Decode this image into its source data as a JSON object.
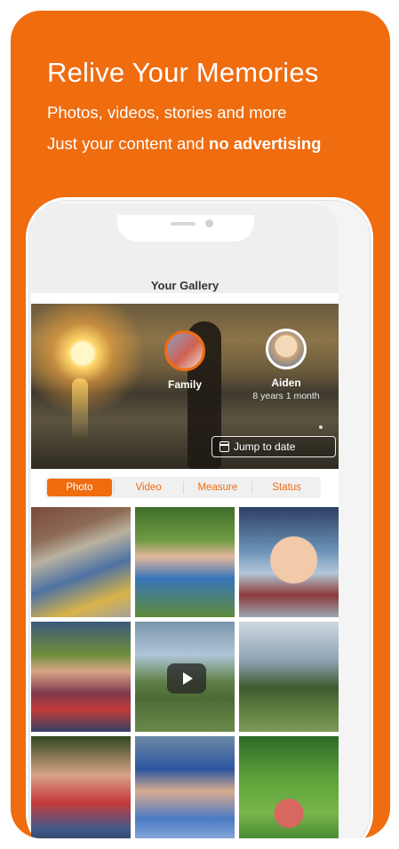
{
  "promo": {
    "title": "Relive Your Memories",
    "line1": "Photos, videos, stories and more",
    "line2_prefix": "Just your content and ",
    "line2_bold": "no advertising"
  },
  "app": {
    "screen_title": "Your Gallery",
    "profiles": [
      {
        "name": "Family",
        "age": ""
      },
      {
        "name": "Aiden",
        "age": "8 years 1 month"
      }
    ],
    "jump_button": "Jump to date",
    "tabs": [
      {
        "label": "Photo",
        "active": true
      },
      {
        "label": "Video",
        "active": false
      },
      {
        "label": "Measure",
        "active": false
      },
      {
        "label": "Status",
        "active": false
      }
    ],
    "gallery_items": [
      {
        "type": "photo"
      },
      {
        "type": "photo"
      },
      {
        "type": "photo"
      },
      {
        "type": "photo"
      },
      {
        "type": "video"
      },
      {
        "type": "photo"
      },
      {
        "type": "photo"
      },
      {
        "type": "photo"
      },
      {
        "type": "photo"
      }
    ]
  },
  "icons": {
    "calendar": "calendar-icon",
    "play": "play-icon"
  },
  "colors": {
    "brand_orange": "#ef6c0f",
    "white": "#ffffff"
  }
}
